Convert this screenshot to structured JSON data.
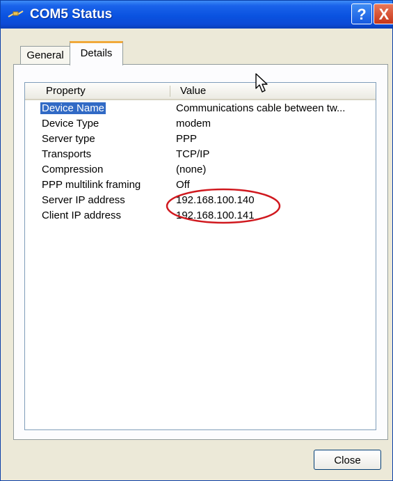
{
  "window": {
    "title": "COM5 Status",
    "help_glyph": "?",
    "close_glyph": "X",
    "icon": "connection-icon"
  },
  "tabs": [
    {
      "label": "General",
      "selected": false
    },
    {
      "label": "Details",
      "selected": true
    }
  ],
  "list": {
    "columns": [
      "Property",
      "Value"
    ],
    "rows": [
      {
        "property": "Device Name",
        "value": "Communications cable between tw...",
        "selected": true
      },
      {
        "property": "Device Type",
        "value": "modem"
      },
      {
        "property": "Server type",
        "value": "PPP"
      },
      {
        "property": "Transports",
        "value": "TCP/IP"
      },
      {
        "property": "Compression",
        "value": "(none)"
      },
      {
        "property": "PPP multilink framing",
        "value": "Off"
      },
      {
        "property": "Server IP address",
        "value": "192.168.100.140"
      },
      {
        "property": "Client IP address",
        "value": "192.168.100.141"
      }
    ]
  },
  "buttons": {
    "close_label": "Close"
  },
  "colors": {
    "titlebar": "#0a52e0",
    "selection": "#316ac5",
    "annotation": "#d0181e",
    "active_tab_accent": "#f0a93b"
  }
}
